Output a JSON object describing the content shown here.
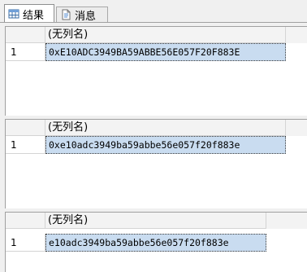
{
  "tabs": [
    {
      "label": "结果",
      "icon": "grid-results-icon",
      "active": true
    },
    {
      "label": "消息",
      "icon": "message-document-icon",
      "active": false
    }
  ],
  "panels": [
    {
      "column_header": "(无列名)",
      "row_number": "1",
      "value": "0xE10ADC3949BA59ABBE56E057F20F883E"
    },
    {
      "column_header": "(无列名)",
      "row_number": "1",
      "value": "0xe10adc3949ba59abbe56e057f20f883e"
    },
    {
      "column_header": "(无列名)",
      "row_number": "1",
      "value": "e10adc3949ba59abbe56e057f20f883e"
    }
  ],
  "colors": {
    "selection": "#c9dcf0",
    "header_bg": "#f3f3f3",
    "grid_line": "#d4d4d4"
  }
}
